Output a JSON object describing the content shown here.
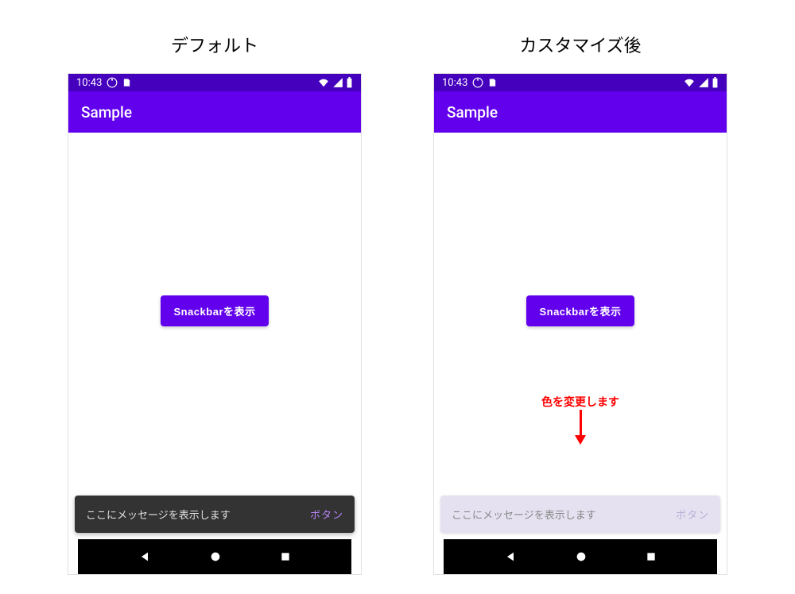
{
  "labels": {
    "default": "デフォルト",
    "customized": "カスタマイズ後"
  },
  "statusBar": {
    "time": "10:43"
  },
  "appBar": {
    "title": "Sample"
  },
  "button": {
    "label": "Snackbarを表示"
  },
  "snackbar": {
    "message": "ここにメッセージを表示します",
    "action": "ボタン"
  },
  "annotation": {
    "text": "色を変更します"
  },
  "colors": {
    "primary": "#6200ee",
    "primaryDark": "#4400bd",
    "snackbarDark": "#333333",
    "snackbarLight": "#e5e1f0",
    "accent": "#bb86fc",
    "annotation": "#ff0000"
  }
}
